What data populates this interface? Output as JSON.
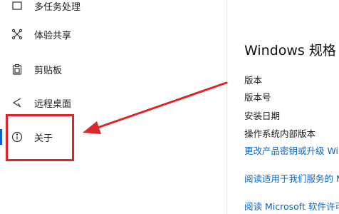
{
  "sidebar": {
    "items": [
      {
        "label": "多任务处理",
        "icon": "multitask-icon"
      },
      {
        "label": "体验共享",
        "icon": "share-experience-icon"
      },
      {
        "label": "剪贴板",
        "icon": "clipboard-icon"
      },
      {
        "label": "远程桌面",
        "icon": "remote-desktop-icon"
      },
      {
        "label": "关于",
        "icon": "info-icon",
        "selected": true
      }
    ]
  },
  "main": {
    "title": "Windows 规格",
    "spec_labels": [
      "版本",
      "版本号",
      "安装日期",
      "操作系统内部版本"
    ],
    "links": [
      "更改产品密钥或升级 Windows",
      "阅读适用于我们服务的 Microsoft 服务协议",
      "阅读 Microsoft 软件许可条款"
    ]
  },
  "colors": {
    "accent": "#0a66c8",
    "annotation_red": "#e0242b"
  }
}
